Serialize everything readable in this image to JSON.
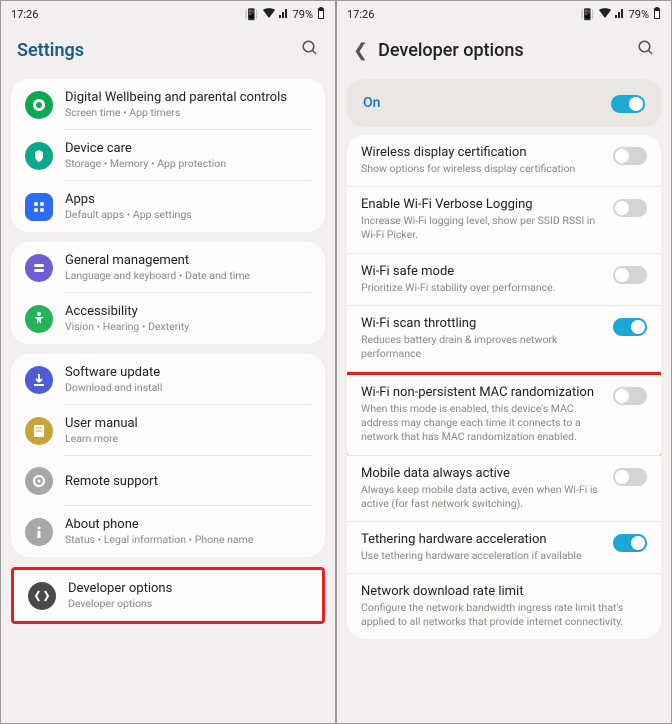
{
  "status": {
    "time": "17:26",
    "battery": "79%"
  },
  "left": {
    "title": "Settings",
    "groups": [
      {
        "items": [
          {
            "icon": "wellbeing",
            "color": "ic-green",
            "title": "Digital Wellbeing and parental controls",
            "sub": "Screen time  •  App timers"
          },
          {
            "icon": "care",
            "color": "ic-teal",
            "title": "Device care",
            "sub": "Storage  •  Memory  •  App protection"
          },
          {
            "icon": "apps",
            "color": "ic-apps",
            "title": "Apps",
            "sub": "Default apps  •  App settings"
          }
        ]
      },
      {
        "items": [
          {
            "icon": "general",
            "color": "ic-purple",
            "title": "General management",
            "sub": "Language and keyboard  •  Date and time"
          },
          {
            "icon": "accessibility",
            "color": "ic-green2",
            "title": "Accessibility",
            "sub": "Vision  •  Hearing  •  Dexterity"
          }
        ]
      },
      {
        "items": [
          {
            "icon": "update",
            "color": "ic-indigo",
            "title": "Software update",
            "sub": "Download and install"
          },
          {
            "icon": "manual",
            "color": "ic-gold",
            "title": "User manual",
            "sub": "Learn more"
          },
          {
            "icon": "remote",
            "color": "ic-grey",
            "title": "Remote support",
            "sub": ""
          },
          {
            "icon": "about",
            "color": "ic-grey",
            "title": "About phone",
            "sub": "Status  •  Legal information  •  Phone name"
          }
        ]
      },
      {
        "highlight": true,
        "items": [
          {
            "icon": "developer",
            "color": "ic-dark",
            "title": "Developer options",
            "sub": "Developer options"
          }
        ]
      }
    ]
  },
  "right": {
    "title": "Developer options",
    "on_label": "On",
    "on_state": true,
    "items": [
      {
        "title": "Wireless display certification",
        "sub": "Show options for wireless display certification",
        "state": false
      },
      {
        "title": "Enable Wi-Fi Verbose Logging",
        "sub": "Increase Wi-Fi logging level, show per SSID RSSI in Wi-Fi Picker.",
        "state": false
      },
      {
        "title": "Wi-Fi safe mode",
        "sub": "Prioritize Wi-Fi stability over performance.",
        "state": false
      },
      {
        "title": "Wi-Fi scan throttling",
        "sub": "Reduces battery drain & improves network performance",
        "state": true
      },
      {
        "title": "Wi-Fi non-persistent MAC randomization",
        "sub": "When this mode is enabled, this device's MAC address may change each time it connects to a network that has MAC randomization enabled.",
        "state": false,
        "highlight": true
      },
      {
        "title": "Mobile data always active",
        "sub": "Always keep mobile data active, even when Wi-Fi is active (for fast network switching).",
        "state": false
      },
      {
        "title": "Tethering hardware acceleration",
        "sub": "Use tethering hardware acceleration if available",
        "state": true
      },
      {
        "title": "Network download rate limit",
        "sub": "Configure the network bandwidth ingress rate limit that's applied to all networks that provide internet connectivity.",
        "state": null
      }
    ]
  }
}
